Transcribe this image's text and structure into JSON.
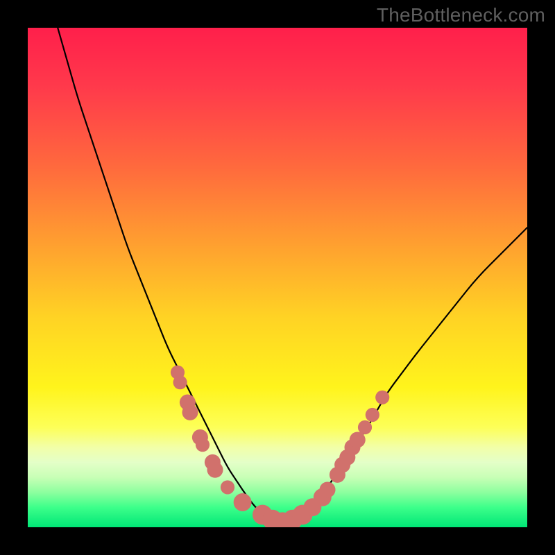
{
  "watermark": "TheBottleneck.com",
  "chart_data": {
    "type": "line",
    "title": "",
    "xlabel": "",
    "ylabel": "",
    "xlim": [
      0,
      100
    ],
    "ylim": [
      0,
      100
    ],
    "series": [
      {
        "name": "bottleneck-curve",
        "x": [
          6,
          8,
          10,
          12,
          14,
          16,
          18,
          20,
          22,
          24,
          26,
          28,
          30,
          32,
          34,
          36,
          38,
          40,
          42,
          44,
          46,
          48,
          50,
          52,
          54,
          56,
          58,
          60,
          62,
          64,
          66,
          68,
          70,
          72,
          75,
          78,
          82,
          86,
          90,
          95,
          100
        ],
        "y": [
          100,
          93,
          86,
          80,
          74,
          68,
          62,
          56,
          51,
          46,
          41,
          36,
          32,
          28,
          24,
          20,
          16,
          12,
          9,
          6,
          3.5,
          2,
          1,
          1,
          2,
          3.5,
          5.5,
          8,
          11,
          14,
          17,
          20,
          23.5,
          27,
          31,
          35,
          40,
          45,
          50,
          55,
          60
        ]
      }
    ],
    "markers": [
      {
        "x": 30,
        "y": 31,
        "r": 1.4
      },
      {
        "x": 30.5,
        "y": 29,
        "r": 1.4
      },
      {
        "x": 32,
        "y": 25,
        "r": 1.6
      },
      {
        "x": 32.5,
        "y": 23,
        "r": 1.6
      },
      {
        "x": 34.5,
        "y": 18,
        "r": 1.6
      },
      {
        "x": 35,
        "y": 16.5,
        "r": 1.4
      },
      {
        "x": 37,
        "y": 13,
        "r": 1.6
      },
      {
        "x": 37.5,
        "y": 11.5,
        "r": 1.6
      },
      {
        "x": 40,
        "y": 8,
        "r": 1.4
      },
      {
        "x": 43,
        "y": 5,
        "r": 1.8
      },
      {
        "x": 47,
        "y": 2.5,
        "r": 2.0
      },
      {
        "x": 49,
        "y": 1.5,
        "r": 2.0
      },
      {
        "x": 51,
        "y": 1.0,
        "r": 2.0
      },
      {
        "x": 53,
        "y": 1.5,
        "r": 2.0
      },
      {
        "x": 55,
        "y": 2.5,
        "r": 2.0
      },
      {
        "x": 57,
        "y": 4.0,
        "r": 1.8
      },
      {
        "x": 59,
        "y": 6.0,
        "r": 1.8
      },
      {
        "x": 60,
        "y": 7.5,
        "r": 1.6
      },
      {
        "x": 62,
        "y": 10.5,
        "r": 1.6
      },
      {
        "x": 63,
        "y": 12.5,
        "r": 1.6
      },
      {
        "x": 64,
        "y": 14.0,
        "r": 1.6
      },
      {
        "x": 65,
        "y": 16.0,
        "r": 1.6
      },
      {
        "x": 66,
        "y": 17.5,
        "r": 1.6
      },
      {
        "x": 67.5,
        "y": 20,
        "r": 1.4
      },
      {
        "x": 69,
        "y": 22.5,
        "r": 1.4
      },
      {
        "x": 71,
        "y": 26,
        "r": 1.4
      }
    ],
    "gradient_stops": [
      {
        "pos": 0,
        "color": "#ff1f4b"
      },
      {
        "pos": 12,
        "color": "#ff3a4b"
      },
      {
        "pos": 28,
        "color": "#ff6a3d"
      },
      {
        "pos": 44,
        "color": "#ffa22f"
      },
      {
        "pos": 58,
        "color": "#ffd324"
      },
      {
        "pos": 72,
        "color": "#fff41c"
      },
      {
        "pos": 80,
        "color": "#fdff58"
      },
      {
        "pos": 84,
        "color": "#f2ffa8"
      },
      {
        "pos": 87,
        "color": "#e4ffc8"
      },
      {
        "pos": 90,
        "color": "#c8ffb6"
      },
      {
        "pos": 93,
        "color": "#8dff9f"
      },
      {
        "pos": 96,
        "color": "#3dff8a"
      },
      {
        "pos": 100,
        "color": "#00e676"
      }
    ]
  }
}
